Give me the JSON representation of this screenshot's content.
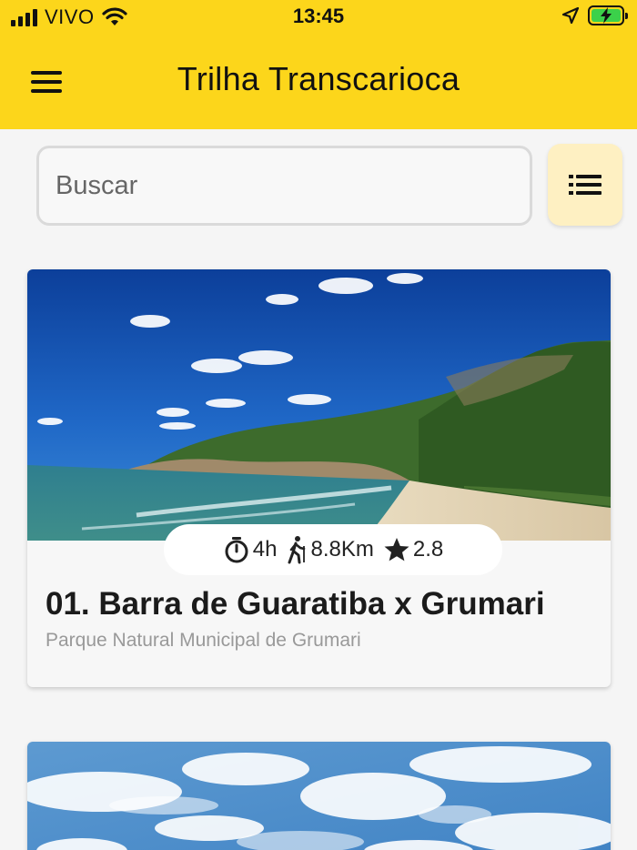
{
  "status_bar": {
    "carrier": "VIVO",
    "time": "13:45",
    "battery_color": "#3bd14a"
  },
  "header": {
    "title": "Trilha Transcarioca",
    "menu_icon": "hamburger-menu-icon",
    "background_color": "#fcd61b"
  },
  "search": {
    "placeholder": "Buscar",
    "value": "",
    "toggle_icon": "list-view-icon"
  },
  "cards": [
    {
      "duration": "4h",
      "distance": "8.8Km",
      "rating": "2.8",
      "title": "01. Barra de Guaratiba x Grumari",
      "subtitle": "Parque Natural Municipal de Grumari",
      "icons": [
        "stopwatch-icon",
        "hiker-icon",
        "star-icon"
      ]
    }
  ]
}
